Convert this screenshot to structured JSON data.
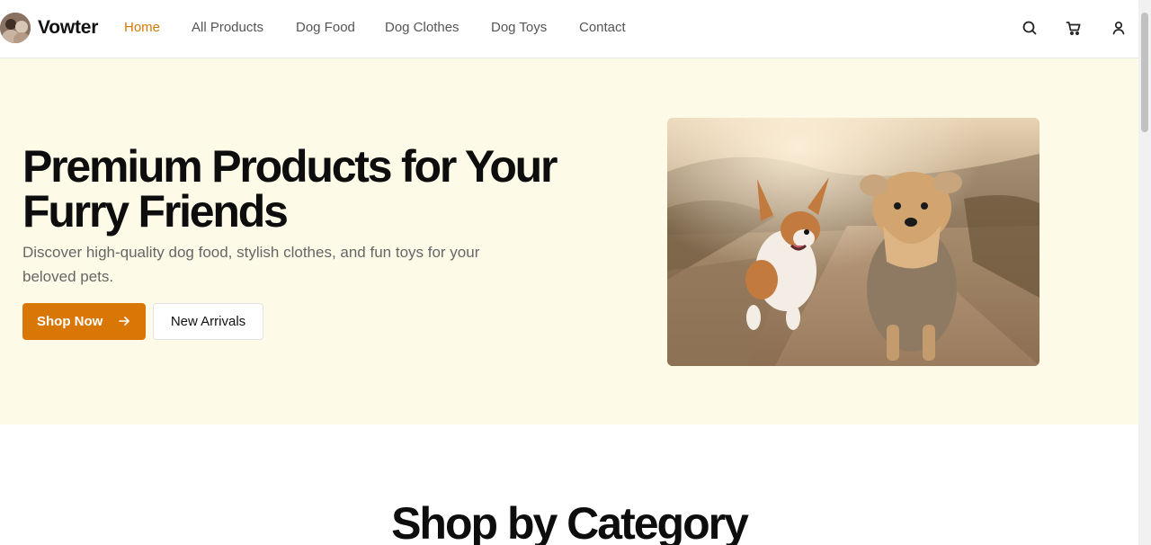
{
  "header": {
    "brand": "Vowter",
    "nav": [
      {
        "label": "Home",
        "active": true
      },
      {
        "label": "All Products",
        "active": false
      },
      {
        "label": "Dog Food",
        "active": false
      },
      {
        "label": "Dog Clothes",
        "active": false
      },
      {
        "label": "Dog Toys",
        "active": false
      },
      {
        "label": "Contact",
        "active": false
      }
    ],
    "icons": [
      "search-icon",
      "cart-icon",
      "user-icon"
    ]
  },
  "hero": {
    "title": "Premium Products for Your Furry Friends",
    "subtitle": "Discover high-quality dog food, stylish clothes, and fun toys for your beloved pets.",
    "primary_button": "Shop Now",
    "secondary_button": "New Arrivals",
    "image_alt": "Two dogs running on a dirt path"
  },
  "categories": {
    "title": "Shop by Category"
  },
  "colors": {
    "accent": "#d97706",
    "hero_bg": "#fefae8",
    "text": "#0d0d0d",
    "muted": "#666666"
  }
}
